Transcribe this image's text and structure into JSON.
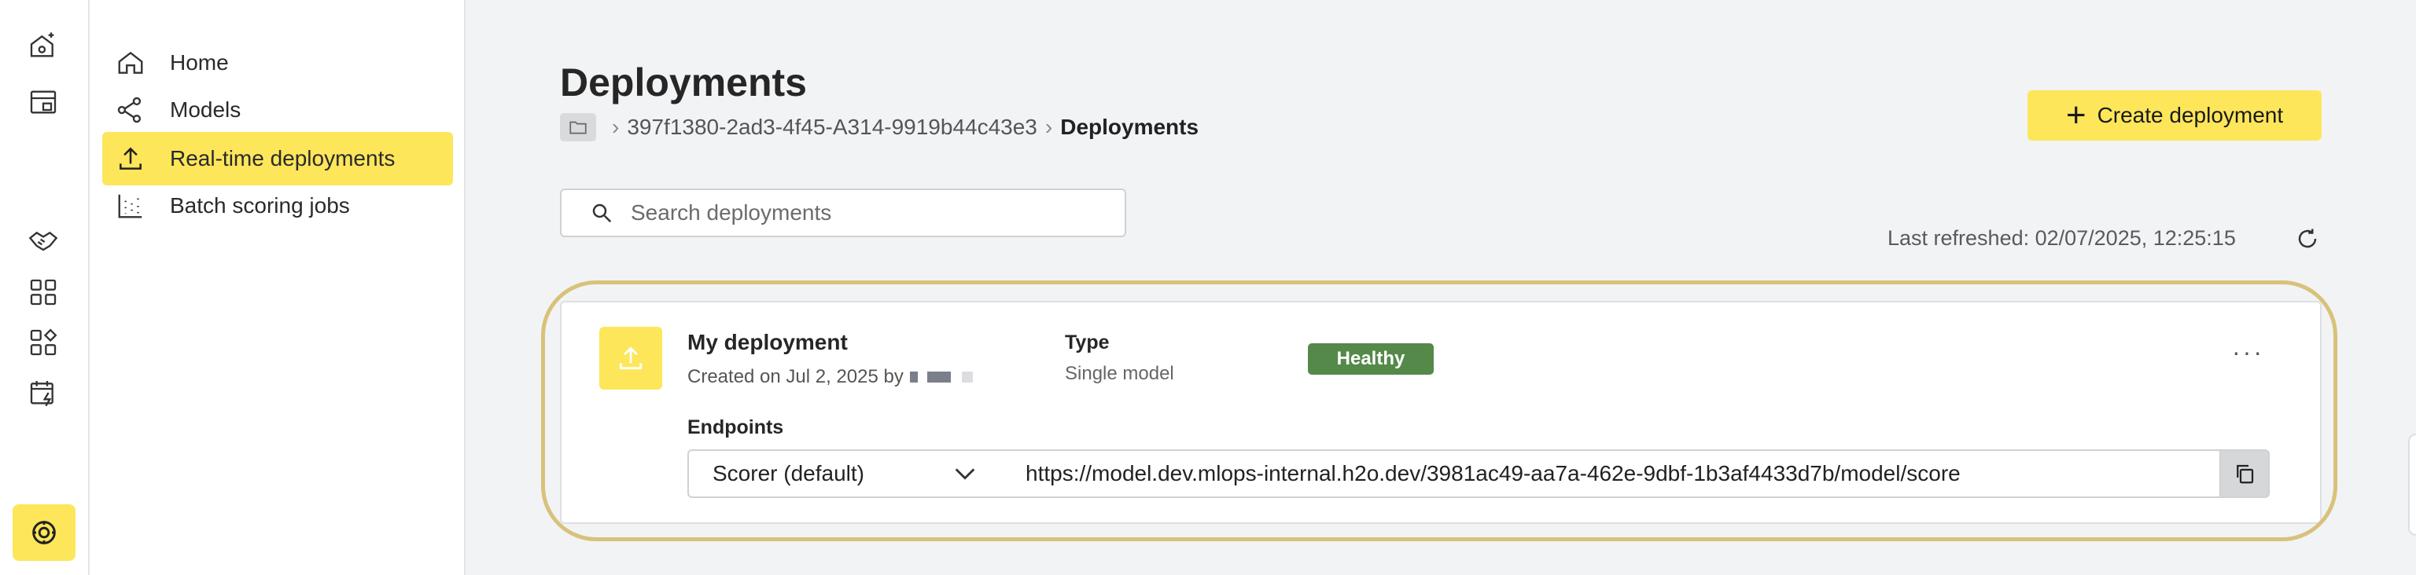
{
  "nav": {
    "items": [
      {
        "label": "Home",
        "icon": "home-icon"
      },
      {
        "label": "Models",
        "icon": "models-icon"
      },
      {
        "label": "Real-time deployments",
        "icon": "upload-icon",
        "active": true
      },
      {
        "label": "Batch scoring jobs",
        "icon": "batch-icon"
      }
    ]
  },
  "header": {
    "title": "Deployments",
    "breadcrumb": {
      "project_id": "397f1380-2ad3-4f45-A314-9919b44c43e3",
      "current": "Deployments"
    },
    "create_button_label": "Create deployment"
  },
  "search": {
    "placeholder": "Search deployments",
    "value": ""
  },
  "refresh": {
    "text": "Last refreshed: 02/07/2025, 12:25:15"
  },
  "deployment": {
    "name": "My deployment",
    "created": "Created on Jul 2, 2025 by",
    "type_label": "Type",
    "type_value": "Single model",
    "status": "Healthy",
    "more_label": "···",
    "endpoints_label": "Endpoints",
    "endpoint_selected": "Scorer (default)",
    "endpoint_url": "https://model.dev.mlops-internal.h2o.dev/3981ac49-aa7a-462e-9dbf-1b3af4433d7b/model/score"
  },
  "colors": {
    "accent": "#fde65a",
    "healthy": "#55894a",
    "highlight_ring": "#d8c27a",
    "background": "#f2f3f4"
  }
}
